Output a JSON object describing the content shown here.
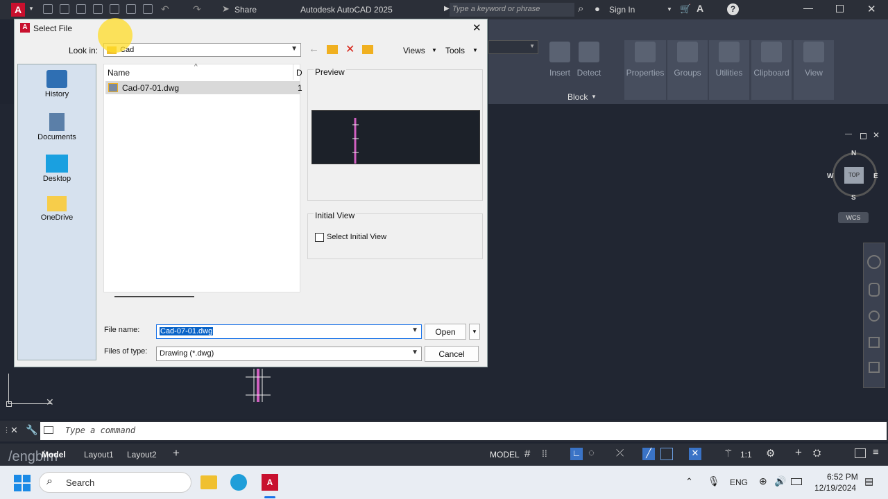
{
  "app": {
    "title": "Autodesk AutoCAD 2025",
    "share_label": "Share",
    "search_placeholder": "Type a keyword or phrase",
    "sign_in": "Sign In",
    "accent": "#c8102e"
  },
  "ribbon": {
    "buttons": [
      "Insert",
      "Detect",
      "Properties",
      "Groups",
      "Utilities",
      "Clipboard",
      "View"
    ],
    "panel_label": "Block"
  },
  "viewcube": {
    "n": "N",
    "s": "S",
    "e": "E",
    "w": "W",
    "top": "TOP",
    "wcs": "WCS"
  },
  "dialog": {
    "title": "Select File",
    "look_in_label": "Look in:",
    "look_in_value": "Cad",
    "views_label": "Views",
    "tools_label": "Tools",
    "places": [
      "History",
      "Documents",
      "Desktop",
      "OneDrive"
    ],
    "columns": [
      "Name",
      "D"
    ],
    "files": [
      {
        "name": "Cad-07-01.dwg",
        "extra": "1"
      }
    ],
    "preview_label": "Preview",
    "initial_view_label": "Initial View",
    "select_initial_view": "Select Initial View",
    "file_name_label": "File name:",
    "file_name_value": "Cad-07-01.dwg",
    "files_of_type_label": "Files of type:",
    "files_of_type_value": "Drawing (*.dwg)",
    "open_label": "Open",
    "cancel_label": "Cancel"
  },
  "command": {
    "placeholder": "Type a command"
  },
  "status": {
    "tabs": [
      "Model",
      "Layout1",
      "Layout2"
    ],
    "model_label": "MODEL",
    "scale": "1:1",
    "watermark": "/engbim"
  },
  "taskbar": {
    "search_label": "Search",
    "language": "ENG",
    "time": "6:52 PM",
    "date": "12/19/2024"
  }
}
